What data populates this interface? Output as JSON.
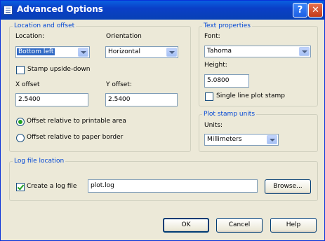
{
  "window": {
    "title": "Advanced Options",
    "help_glyph": "?",
    "close_glyph": "✕"
  },
  "location_offset": {
    "legend": "Location and offset",
    "location_label": "Location:",
    "location_value": "Bottom left",
    "orientation_label": "Orientation",
    "orientation_value": "Horizontal",
    "stamp_upside_down_label": "Stamp upside-down",
    "stamp_upside_down_checked": false,
    "x_offset_label": "X offset",
    "x_offset_value": "2.5400",
    "y_offset_label": "Y offset:",
    "y_offset_value": "2.5400",
    "radio_printable_label": "Offset relative to printable area",
    "radio_paper_label": "Offset relative to paper border",
    "selected_radio": "printable"
  },
  "text_properties": {
    "legend": "Text properties",
    "font_label": "Font:",
    "font_value": "Tahoma",
    "height_label": "Height:",
    "height_value": "5.0800",
    "single_line_label": "Single line plot stamp",
    "single_line_checked": false
  },
  "plot_units": {
    "legend": "Plot stamp units",
    "units_label": "Units:",
    "units_value": "Millimeters"
  },
  "log_file": {
    "legend": "Log file location",
    "create_label": "Create a log file",
    "create_checked": true,
    "path_value": "plot.log",
    "browse_label": "Browse..."
  },
  "buttons": {
    "ok": "OK",
    "cancel": "Cancel",
    "help": "Help"
  }
}
